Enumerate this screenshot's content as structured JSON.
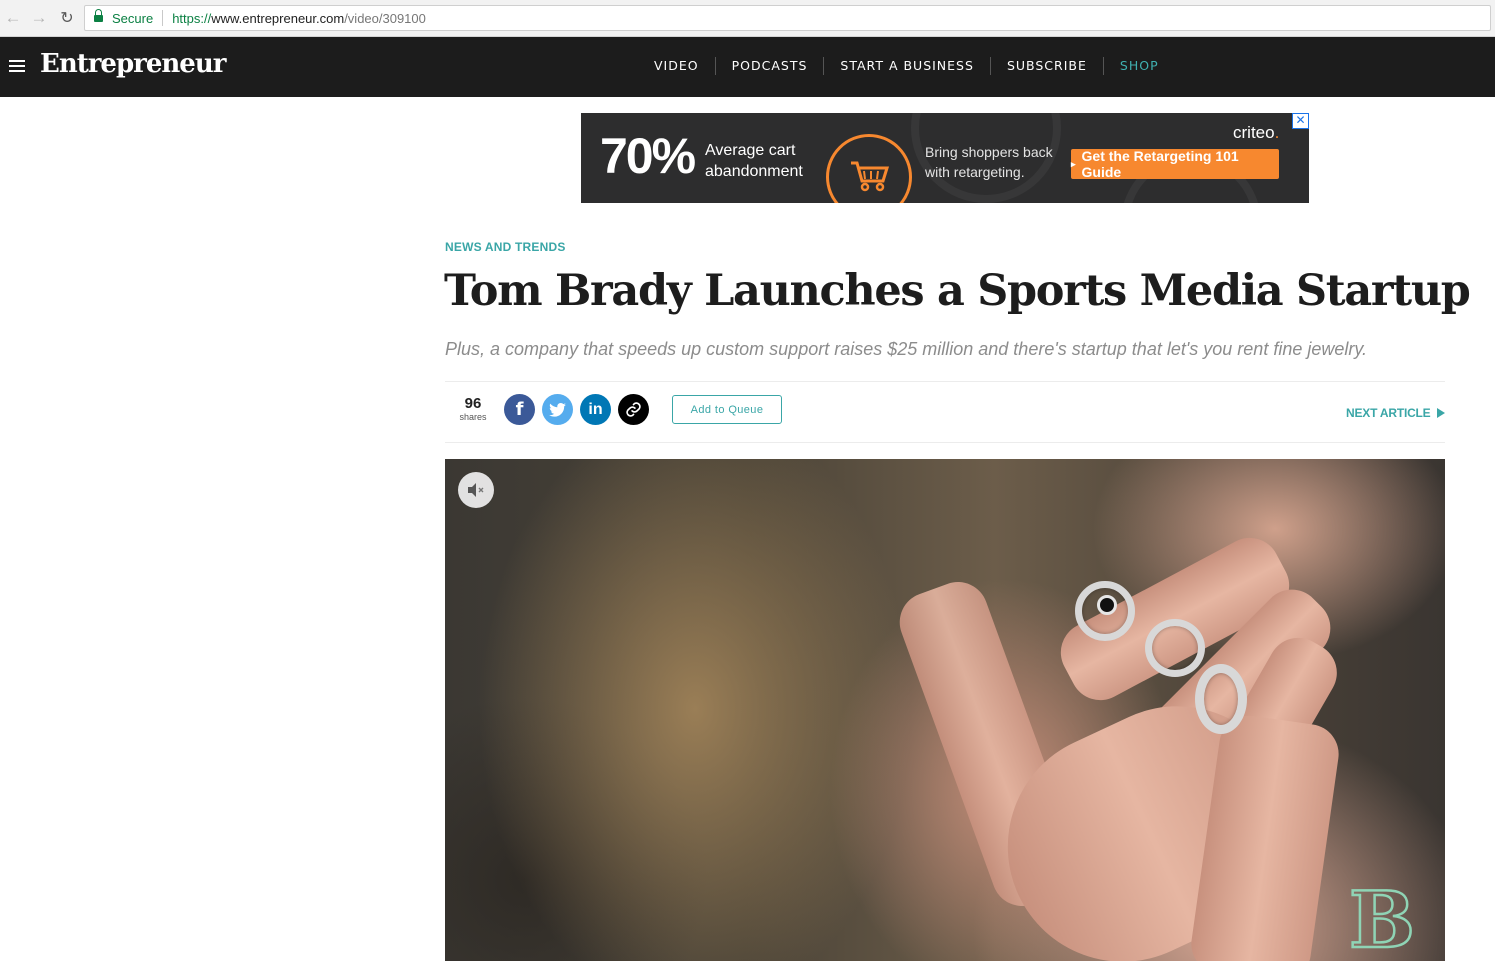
{
  "browser": {
    "secure_label": "Secure",
    "url_scheme": "https://",
    "url_host": "www.entrepreneur.com",
    "url_path": "/video/309100"
  },
  "header": {
    "logo": "Entrepreneur",
    "nav": [
      "VIDEO",
      "PODCASTS",
      "START A BUSINESS",
      "SUBSCRIBE",
      "SHOP"
    ]
  },
  "ad": {
    "percent": "70%",
    "line1": "Average cart",
    "line2": "abandonment",
    "copy1": "Bring shoppers back",
    "copy2": "with retargeting.",
    "cta": "Get the Retargeting 101 Guide",
    "brand": "criteo",
    "accent": "#f7882f"
  },
  "article": {
    "kicker": "NEWS AND TRENDS",
    "headline": "Tom Brady Launches a Sports Media Startup",
    "dek": "Plus, a company that speeds up custom support raises $25 million and there's startup that let's you rent fine jewelry.",
    "share_count": "96",
    "share_label": "shares",
    "queue_label": "Add to Queue",
    "next_label": "NEXT ARTICLE"
  },
  "colors": {
    "teal": "#3aa6a7",
    "facebook": "#3b5998",
    "twitter": "#55acee",
    "linkedin": "#0077b5",
    "link": "#000000"
  },
  "icons": {
    "facebook": "f",
    "twitter": "bird",
    "linkedin": "in",
    "link": "chain",
    "mute": "speaker-muted",
    "cart": "shopping-cart"
  }
}
